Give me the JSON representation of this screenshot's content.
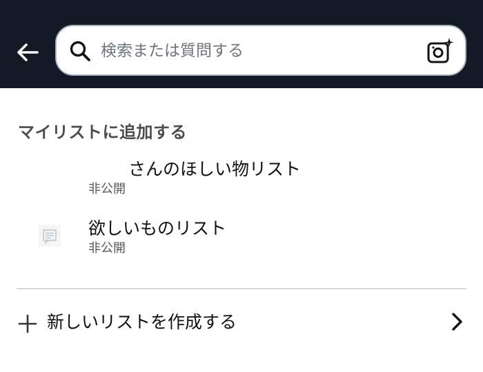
{
  "header": {
    "back_icon": "back-arrow-icon",
    "search": {
      "placeholder": "検索または質問する",
      "value": "",
      "search_icon": "search-icon",
      "camera_icon": "camera-sparkle-icon"
    }
  },
  "colors": {
    "header_bg": "#131a26",
    "search_border": "#a9b2bd",
    "section_title": "#4a4d52",
    "secondary_text": "#565959",
    "divider": "#d5d9d9"
  },
  "section": {
    "title": "マイリストに追加する"
  },
  "lists": [
    {
      "name": "さんのほしい物リスト",
      "visibility": "非公開"
    },
    {
      "name": "欲しいものリスト",
      "visibility": "非公開",
      "thumb_icon": "list-thumbnail-icon"
    }
  ],
  "create": {
    "label": "新しいリストを作成する",
    "plus_icon": "plus-icon",
    "chevron_icon": "chevron-right-icon"
  }
}
